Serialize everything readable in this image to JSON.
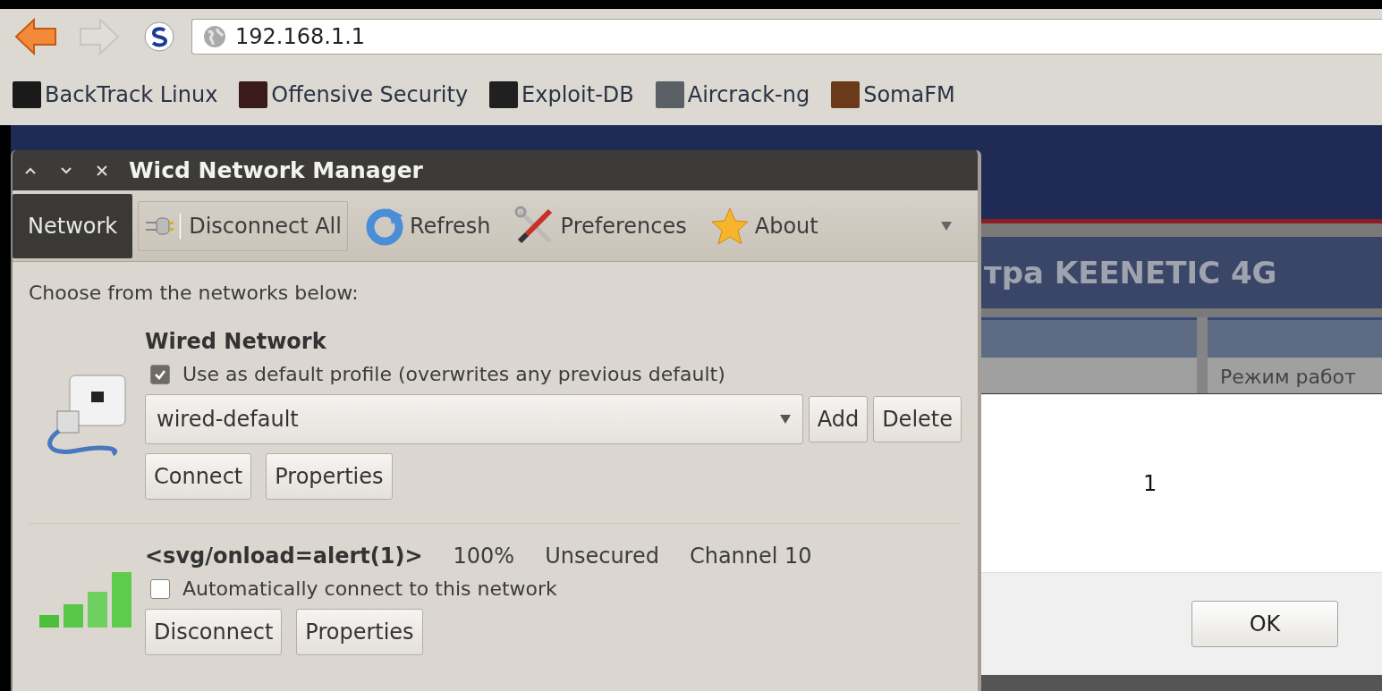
{
  "browser": {
    "address": "192.168.1.1",
    "bookmarks": [
      {
        "label": "BackTrack Linux",
        "color": "#1a1a1a"
      },
      {
        "label": "Offensive Security",
        "color": "#3a1a1a"
      },
      {
        "label": "Exploit-DB",
        "color": "#202020"
      },
      {
        "label": "Aircrack-ng",
        "color": "#5a6066"
      },
      {
        "label": "SomaFM",
        "color": "#6a3a1a"
      }
    ]
  },
  "web_page": {
    "title": "тра KEENETIC 4G",
    "column_label": "Режим работ",
    "dialog": {
      "message": "1",
      "button": "OK"
    }
  },
  "wicd": {
    "title": "Wicd Network Manager",
    "toolbar": [
      {
        "kind": "tab",
        "label": "Network",
        "selected": true
      },
      {
        "kind": "disconnect",
        "label": "Disconnect All",
        "selected": false
      },
      {
        "kind": "refresh",
        "label": "Refresh",
        "selected": false
      },
      {
        "kind": "preferences",
        "label": "Preferences",
        "selected": false
      },
      {
        "kind": "about",
        "label": "About",
        "selected": false
      }
    ],
    "prompt": "Choose from the networks below:",
    "networks": [
      {
        "kind": "wired",
        "name": "Wired Network",
        "option": {
          "label": "Use as default profile (overwrites any previous default)",
          "checked": true
        },
        "profile": "wired-default",
        "profile_buttons": [
          "Add",
          "Delete"
        ],
        "buttons": [
          "Connect",
          "Properties"
        ]
      },
      {
        "kind": "wireless",
        "name": "<svg/onload=alert(1)>",
        "strength": "100%",
        "security": "Unsecured",
        "channel": "Channel 10",
        "option": {
          "label": "Automatically connect to this network",
          "checked": false
        },
        "buttons": [
          "Disconnect",
          "Properties"
        ]
      }
    ]
  }
}
